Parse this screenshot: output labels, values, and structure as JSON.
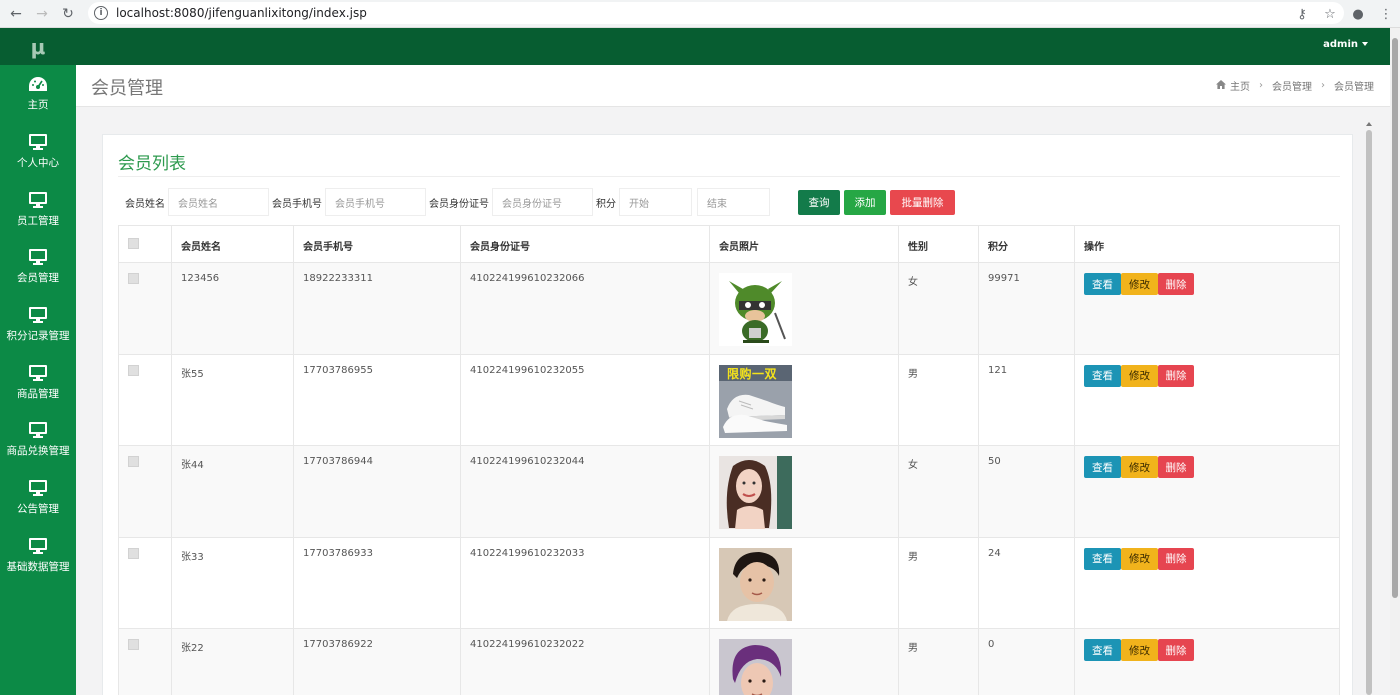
{
  "browser": {
    "url": "localhost:8080/jifenguanlixitong/index.jsp"
  },
  "sidebar": {
    "logo": "μ",
    "items": [
      {
        "label": "主页",
        "icon": "dashboard-icon"
      },
      {
        "label": "个人中心",
        "icon": "monitor-icon"
      },
      {
        "label": "员工管理",
        "icon": "monitor-icon"
      },
      {
        "label": "会员管理",
        "icon": "monitor-icon"
      },
      {
        "label": "积分记录管理",
        "icon": "monitor-icon"
      },
      {
        "label": "商品管理",
        "icon": "monitor-icon"
      },
      {
        "label": "商品兑换管理",
        "icon": "monitor-icon"
      },
      {
        "label": "公告管理",
        "icon": "monitor-icon"
      },
      {
        "label": "基础数据管理",
        "icon": "monitor-icon"
      }
    ]
  },
  "header": {
    "user": "admin"
  },
  "page": {
    "title": "会员管理",
    "breadcrumb": [
      "主页",
      "会员管理",
      "会员管理"
    ]
  },
  "panel": {
    "title": "会员列表"
  },
  "filters": {
    "name_label": "会员姓名",
    "name_placeholder": "会员姓名",
    "phone_label": "会员手机号",
    "phone_placeholder": "会员手机号",
    "id_label": "会员身份证号",
    "id_placeholder": "会员身份证号",
    "points_label": "积分",
    "start_placeholder": "开始",
    "end_placeholder": "结束",
    "query_button": "查询",
    "add_button": "添加",
    "bulk_delete_button": "批量删除"
  },
  "table": {
    "headers": [
      "会员姓名",
      "会员手机号",
      "会员身份证号",
      "会员照片",
      "性别",
      "积分",
      "操作"
    ],
    "rows": [
      {
        "name": "123456",
        "phone": "18922233311",
        "id": "410224199610232066",
        "photo": "avatar-cartoon-ninja",
        "gender": "女",
        "points": "99971"
      },
      {
        "name": "张55",
        "phone": "17703786955",
        "id": "410224199610232055",
        "photo": "sneakers-promo",
        "photo_caption": "限购一双",
        "gender": "男",
        "points": "121"
      },
      {
        "name": "张44",
        "phone": "17703786944",
        "id": "410224199610232044",
        "photo": "portrait-woman",
        "gender": "女",
        "points": "50"
      },
      {
        "name": "张33",
        "phone": "17703786933",
        "id": "410224199610232033",
        "photo": "portrait-man",
        "gender": "男",
        "points": "24"
      },
      {
        "name": "张22",
        "phone": "17703786922",
        "id": "410224199610232022",
        "photo": "portrait-man-purple-hair",
        "gender": "男",
        "points": "0"
      }
    ],
    "actions": {
      "view": "查看",
      "edit": "修改",
      "delete": "删除"
    }
  }
}
